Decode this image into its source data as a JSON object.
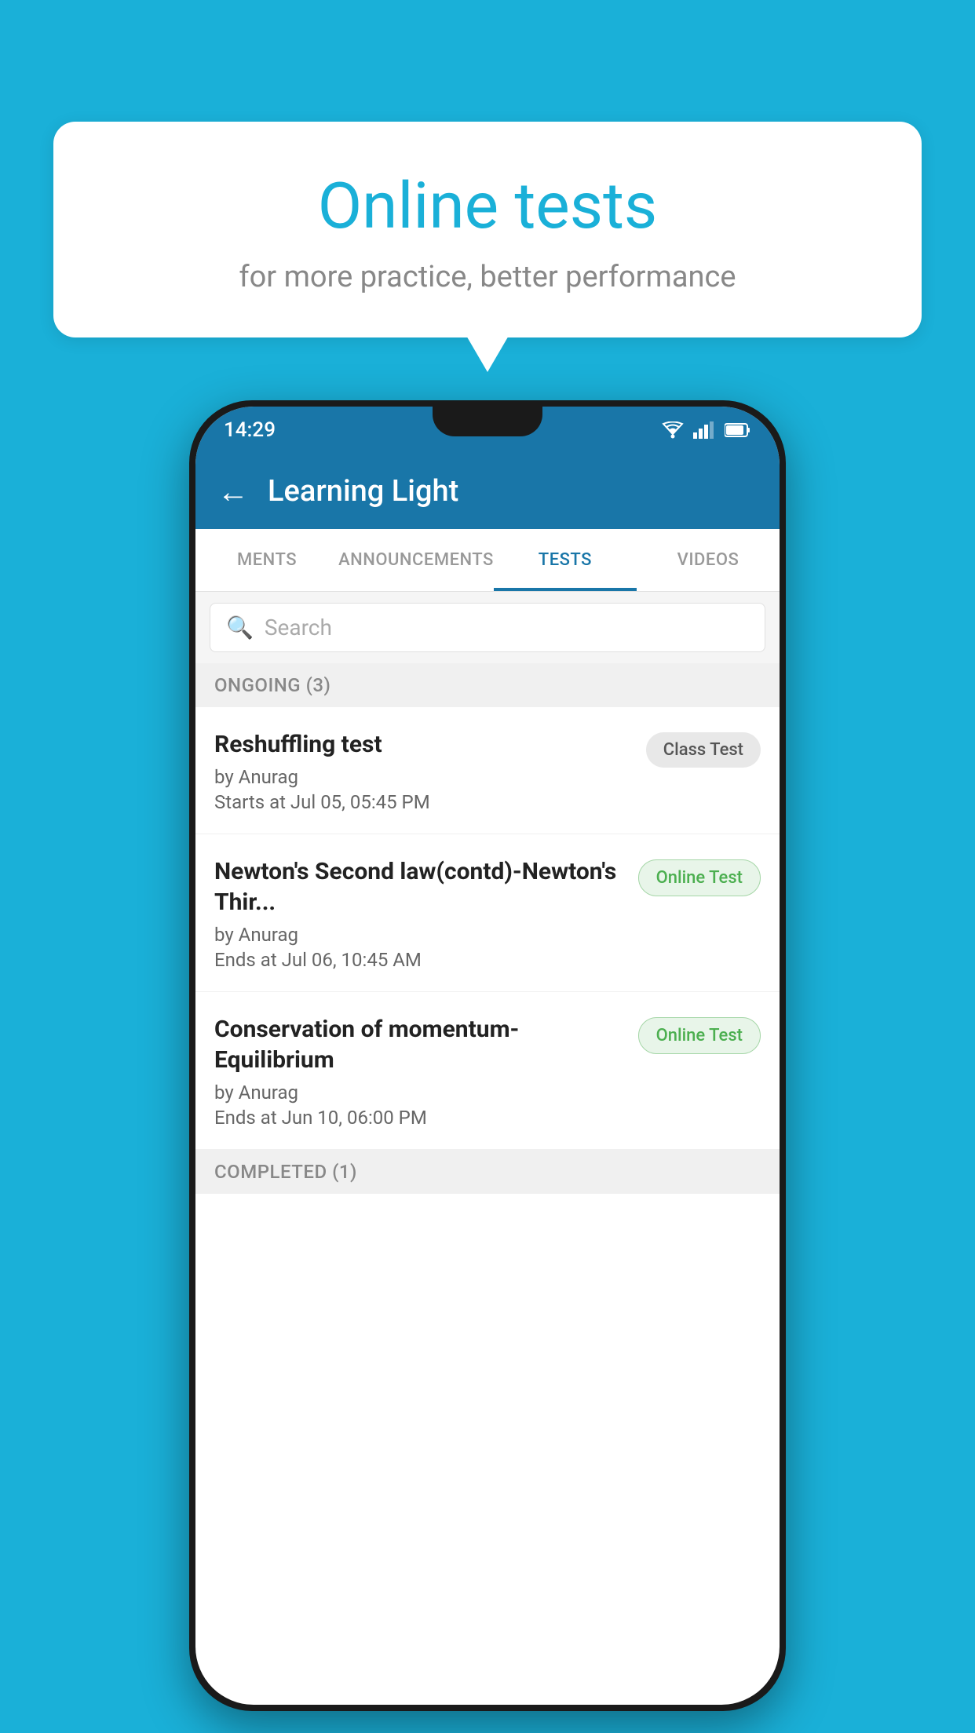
{
  "background": {
    "color": "#1ab0d8"
  },
  "speech_bubble": {
    "title": "Online tests",
    "subtitle": "for more practice, better performance"
  },
  "status_bar": {
    "time": "14:29",
    "icons": [
      "wifi",
      "signal",
      "battery"
    ]
  },
  "app_bar": {
    "title": "Learning Light",
    "back_label": "←"
  },
  "tabs": [
    {
      "label": "MENTS",
      "active": false
    },
    {
      "label": "ANNOUNCEMENTS",
      "active": false
    },
    {
      "label": "TESTS",
      "active": true
    },
    {
      "label": "VIDEOS",
      "active": false
    }
  ],
  "search": {
    "placeholder": "Search"
  },
  "sections": [
    {
      "header": "ONGOING (3)",
      "items": [
        {
          "title": "Reshuffling test",
          "by": "by Anurag",
          "date": "Starts at  Jul 05, 05:45 PM",
          "badge": "Class Test",
          "badge_type": "class"
        },
        {
          "title": "Newton's Second law(contd)-Newton's Thir...",
          "by": "by Anurag",
          "date": "Ends at  Jul 06, 10:45 AM",
          "badge": "Online Test",
          "badge_type": "online"
        },
        {
          "title": "Conservation of momentum-Equilibrium",
          "by": "by Anurag",
          "date": "Ends at  Jun 10, 06:00 PM",
          "badge": "Online Test",
          "badge_type": "online"
        }
      ]
    }
  ],
  "completed_header": "COMPLETED (1)"
}
